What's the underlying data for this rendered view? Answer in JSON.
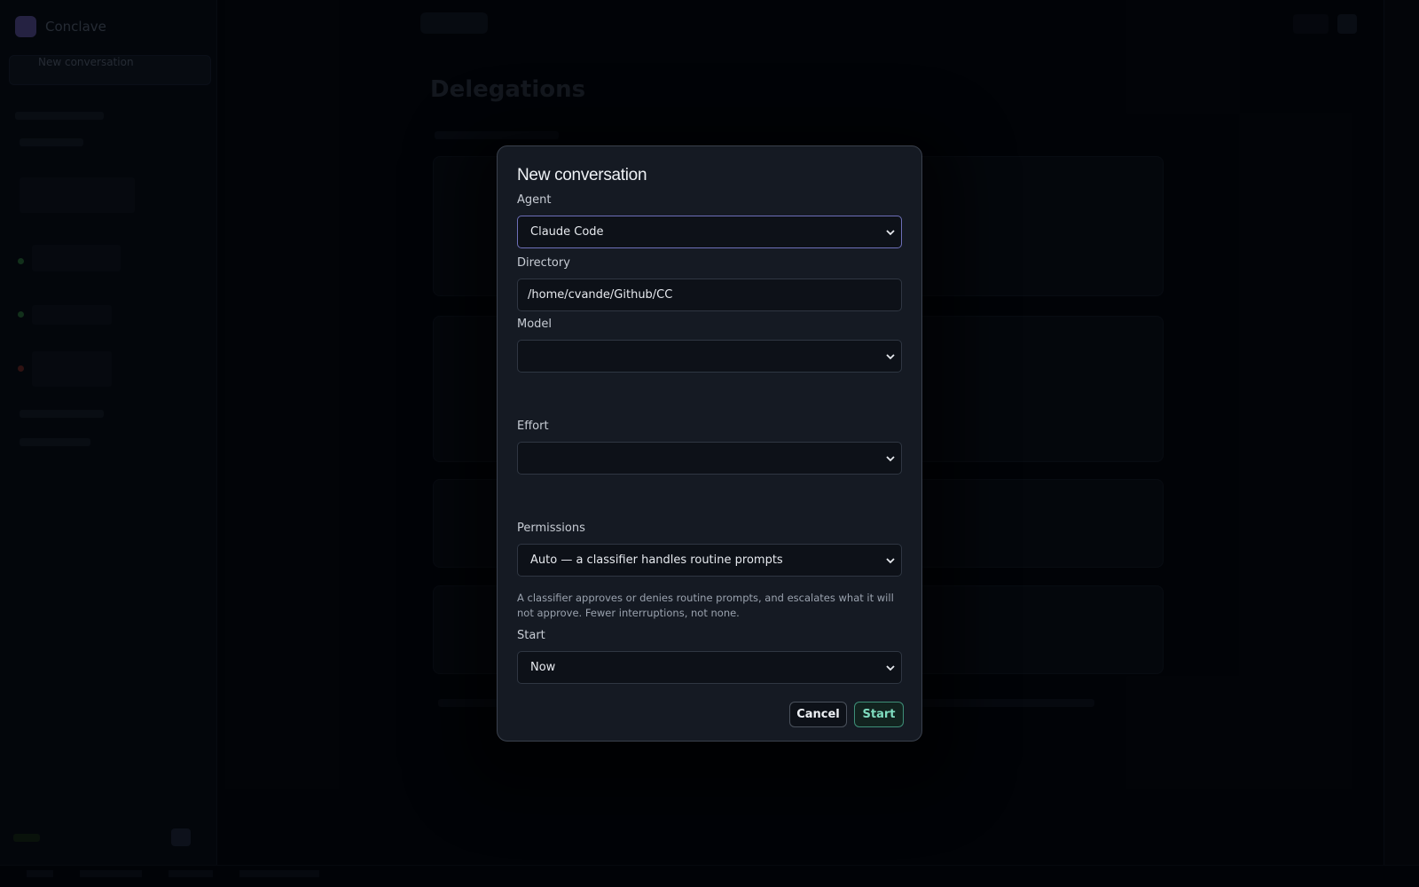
{
  "background": {
    "brand": "Conclave",
    "new_conversation": "New conversation",
    "page_title": "Delegations"
  },
  "modal": {
    "title": "New conversation",
    "agent": {
      "label": "Agent",
      "value": "Claude Code"
    },
    "directory": {
      "label": "Directory",
      "value": "/home/cvande/Github/CC"
    },
    "model": {
      "label": "Model",
      "value": ""
    },
    "effort": {
      "label": "Effort",
      "value": ""
    },
    "permissions": {
      "label": "Permissions",
      "value": "Auto — a classifier handles routine prompts",
      "help": "A classifier approves or denies routine prompts, and escalates what it will not approve. Fewer interruptions, not none."
    },
    "start": {
      "label": "Start",
      "value": "Now"
    },
    "cancel_label": "Cancel",
    "start_label": "Start"
  },
  "colors": {
    "accent_focus": "#6d6fb8",
    "start_green": "#7fdcbf",
    "modal_bg": "#151a23"
  },
  "icons": {
    "select": "chevron-down-icon"
  }
}
